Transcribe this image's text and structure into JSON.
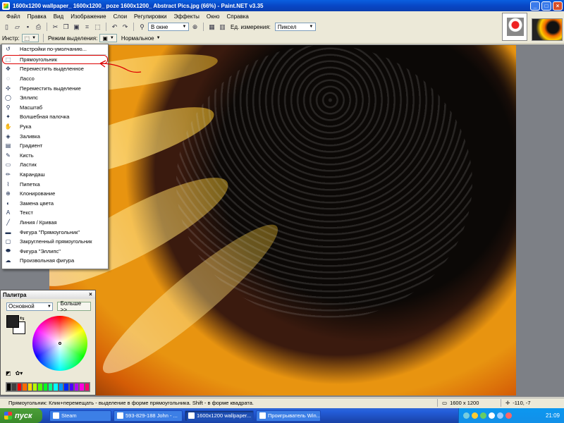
{
  "window": {
    "title": "1600x1200 wallpaper_ 1600x1200_ poze 1600x1200_ Abstract Pics.jpg (66%) - Paint.NET v3.35",
    "minimize": "_",
    "maximize": "□",
    "close": "×"
  },
  "menu": [
    "Файл",
    "Правка",
    "Вид",
    "Изображение",
    "Слои",
    "Регулировки",
    "Эффекты",
    "Окно",
    "Справка"
  ],
  "toolbar": {
    "zoom_value": "В окне",
    "units_label": "Ед. измерения:",
    "units_value": "Пиксел"
  },
  "toolbar2": {
    "tool_label": "Инстр:",
    "selection_mode_label": "Режим выделения:",
    "selection_mode_value": "Нормальное"
  },
  "tool_menu": {
    "defaults": "Настройки по-умолчанию...",
    "items": [
      {
        "label": "Прямоугольник",
        "icon": "rect-select-icon",
        "glyph": "⬚"
      },
      {
        "label": "Переместить выделенное",
        "icon": "move-selected-icon",
        "glyph": "✥"
      },
      {
        "label": "Лассо",
        "icon": "lasso-icon",
        "glyph": "◌"
      },
      {
        "label": "Переместить выделение",
        "icon": "move-selection-icon",
        "glyph": "✣"
      },
      {
        "label": "Эллипс",
        "icon": "ellipse-select-icon",
        "glyph": "◯"
      },
      {
        "label": "Масштаб",
        "icon": "zoom-icon",
        "glyph": "⚲"
      },
      {
        "label": "Волшебная палочка",
        "icon": "magic-wand-icon",
        "glyph": "✦"
      },
      {
        "label": "Рука",
        "icon": "hand-icon",
        "glyph": "✋"
      },
      {
        "label": "Заливка",
        "icon": "bucket-icon",
        "glyph": "◈"
      },
      {
        "label": "Градиент",
        "icon": "gradient-icon",
        "glyph": "▤"
      },
      {
        "label": "Кисть",
        "icon": "brush-icon",
        "glyph": "✎"
      },
      {
        "label": "Ластик",
        "icon": "eraser-icon",
        "glyph": "▭"
      },
      {
        "label": "Карандаш",
        "icon": "pencil-icon",
        "glyph": "✏"
      },
      {
        "label": "Пипетка",
        "icon": "eyedropper-icon",
        "glyph": "⌇"
      },
      {
        "label": "Клонирование",
        "icon": "clone-stamp-icon",
        "glyph": "⊕"
      },
      {
        "label": "Замена цвета",
        "icon": "recolor-icon",
        "glyph": "◐"
      },
      {
        "label": "Текст",
        "icon": "text-icon",
        "glyph": "A"
      },
      {
        "label": "Линия / Кривая",
        "icon": "line-icon",
        "glyph": "╱"
      },
      {
        "label": "Фигура \"Прямоугольник\"",
        "icon": "rectangle-shape-icon",
        "glyph": "▬"
      },
      {
        "label": "Закругленный прямоугольник",
        "icon": "rounded-rect-icon",
        "glyph": "▢"
      },
      {
        "label": "Фигура \"Эллипс\"",
        "icon": "ellipse-shape-icon",
        "glyph": "⬬"
      },
      {
        "label": "Произвольная фигура",
        "icon": "freeform-shape-icon",
        "glyph": "☁"
      }
    ]
  },
  "palette": {
    "title": "Палитра",
    "close": "×",
    "mode": "Основной",
    "more_button": "Больше >>",
    "primary_color": "#222222",
    "secondary_color": "#ffffff",
    "swatches": [
      "#000000",
      "#404040",
      "#ff0000",
      "#ff6a00",
      "#ffd800",
      "#b6ff00",
      "#4cff00",
      "#00ff21",
      "#00ff90",
      "#00ffff",
      "#0094ff",
      "#0026ff",
      "#4800ff",
      "#b200ff",
      "#ff00dc",
      "#ff006e"
    ]
  },
  "status": {
    "hint": "Прямоугольник: Клик+перемещать - выделение в форме прямоугольника. Shift - в форме квадрата.",
    "image_size": "1600 x 1200",
    "cursor_pos": "-110, -7"
  },
  "taskbar": {
    "start": "пуск",
    "tasks": [
      "Steam",
      "593-829-188 John - ...",
      "1600x1200 wallpaper...",
      "Проигрыватель Win..."
    ],
    "active_index": 2,
    "clock": "21:09"
  }
}
